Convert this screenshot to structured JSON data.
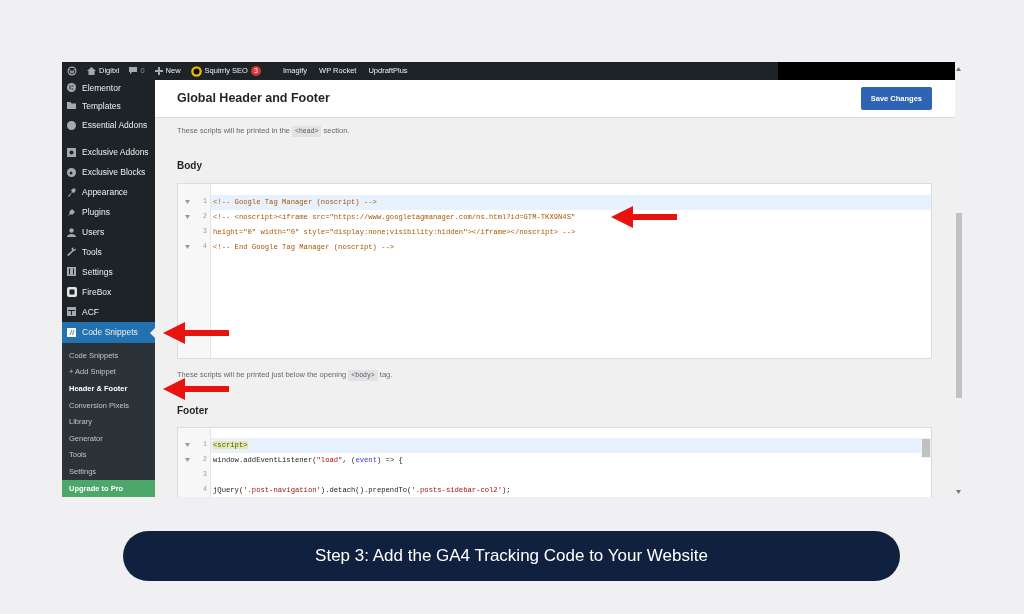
{
  "admin_bar": {
    "site": "Digitxl",
    "comments": "0",
    "new_label": "New",
    "seo_label": "Squirrly SEO",
    "seo_badge": "3",
    "items": [
      "Imagify",
      "WP Rocket",
      "UpdraftPlus"
    ]
  },
  "sidebar": {
    "items": [
      {
        "label": "Elementor",
        "selected": false,
        "separator_after": false,
        "pointed": false
      },
      {
        "label": "Templates",
        "selected": false,
        "separator_after": false,
        "pointed": false
      },
      {
        "label": "Essential Addons",
        "selected": false,
        "separator_after": true,
        "pointed": false
      },
      {
        "label": "Exclusive Addons",
        "selected": false,
        "separator_after": false,
        "pointed": false
      },
      {
        "label": "Exclusive Blocks",
        "selected": false,
        "separator_after": false,
        "pointed": false
      },
      {
        "label": "Appearance",
        "selected": false,
        "separator_after": false,
        "pointed": false
      },
      {
        "label": "Plugins",
        "selected": false,
        "separator_after": false,
        "pointed": false
      },
      {
        "label": "Users",
        "selected": false,
        "separator_after": false,
        "pointed": false
      },
      {
        "label": "Tools",
        "selected": false,
        "separator_after": false,
        "pointed": false
      },
      {
        "label": "Settings",
        "selected": false,
        "separator_after": false,
        "pointed": false
      },
      {
        "label": "FireBox",
        "selected": false,
        "separator_after": false,
        "pointed": false
      },
      {
        "label": "ACF",
        "selected": false,
        "separator_after": false,
        "pointed": false
      },
      {
        "label": "Code Snippets",
        "selected": true,
        "separator_after": false,
        "pointed": true,
        "children": [
          {
            "label": "Code Snippets",
            "selected": false,
            "pointed": false
          },
          {
            "label": "+ Add Snippet",
            "selected": false,
            "pointed": false
          },
          {
            "label": "Header & Footer",
            "selected": true,
            "pointed": true
          },
          {
            "label": "Conversion Pixels",
            "selected": false,
            "pointed": false
          },
          {
            "label": "Library",
            "selected": false,
            "pointed": false
          },
          {
            "label": "Generator",
            "selected": false,
            "pointed": false
          },
          {
            "label": "Tools",
            "selected": false,
            "pointed": false
          },
          {
            "label": "Settings",
            "selected": false,
            "pointed": false
          }
        ]
      }
    ],
    "upgrade": "Upgrade to Pro"
  },
  "page": {
    "title": "Global Header and Footer",
    "save_button": "Save Changes"
  },
  "head_note": {
    "before": "These scripts will be printed in the",
    "code": "<head>",
    "after": "section."
  },
  "sections": [
    {
      "heading": "Body",
      "editor": {
        "lines": [
          {
            "number": "1",
            "fold": true,
            "highlighted": true,
            "pointed": false,
            "tokens": [
              {
                "kind": "comment",
                "text": "<!-- Google Tag Manager (noscript) -->"
              }
            ]
          },
          {
            "number": "2",
            "fold": true,
            "highlighted": false,
            "pointed": true,
            "tokens": [
              {
                "kind": "comment",
                "text": "<!-- <noscript><iframe src=\"https://www.googletagmanager.com/ns.html?id=GTM-TKX9N4S\""
              }
            ]
          },
          {
            "number": "3",
            "fold": false,
            "highlighted": false,
            "pointed": false,
            "tokens": [
              {
                "kind": "comment",
                "text": "height=\"0\" width=\"0\" style=\"display:none;visibility:hidden\"></iframe></noscript> -->"
              }
            ]
          },
          {
            "number": "4",
            "fold": true,
            "highlighted": false,
            "pointed": false,
            "tokens": [
              {
                "kind": "comment",
                "text": "<!-- End Google Tag Manager (noscript) -->"
              }
            ]
          }
        ]
      },
      "note": {
        "before": "These scripts will be printed just below the opening",
        "code": "<body>",
        "after": "tag."
      }
    },
    {
      "heading": "Footer",
      "editor": {
        "lines": [
          {
            "number": "1",
            "fold": true,
            "highlighted": true,
            "pointed": false,
            "tokens": [
              {
                "kind": "tag",
                "text": "<script>"
              }
            ]
          },
          {
            "number": "2",
            "fold": true,
            "highlighted": false,
            "pointed": false,
            "tokens": [
              {
                "kind": "plain",
                "text": "window.addEventListener("
              },
              {
                "kind": "string",
                "text": "\"load\""
              },
              {
                "kind": "plain",
                "text": ", ("
              },
              {
                "kind": "variable",
                "text": "event"
              },
              {
                "kind": "plain",
                "text": ") => {"
              }
            ]
          },
          {
            "number": "3",
            "fold": false,
            "highlighted": false,
            "pointed": false
          },
          {
            "number": "4",
            "fold": false,
            "highlighted": false,
            "pointed": false,
            "tokens": [
              {
                "kind": "plain",
                "text": "jQuery("
              },
              {
                "kind": "string",
                "text": "'.post-navigation'"
              },
              {
                "kind": "plain",
                "text": ").detach().prependTo("
              },
              {
                "kind": "string",
                "text": "'.posts-sidebar-col2'"
              },
              {
                "kind": "plain",
                "text": ");"
              }
            ]
          }
        ]
      }
    }
  ],
  "caption": "Step 3: Add the GA4 Tracking Code to Your Website"
}
